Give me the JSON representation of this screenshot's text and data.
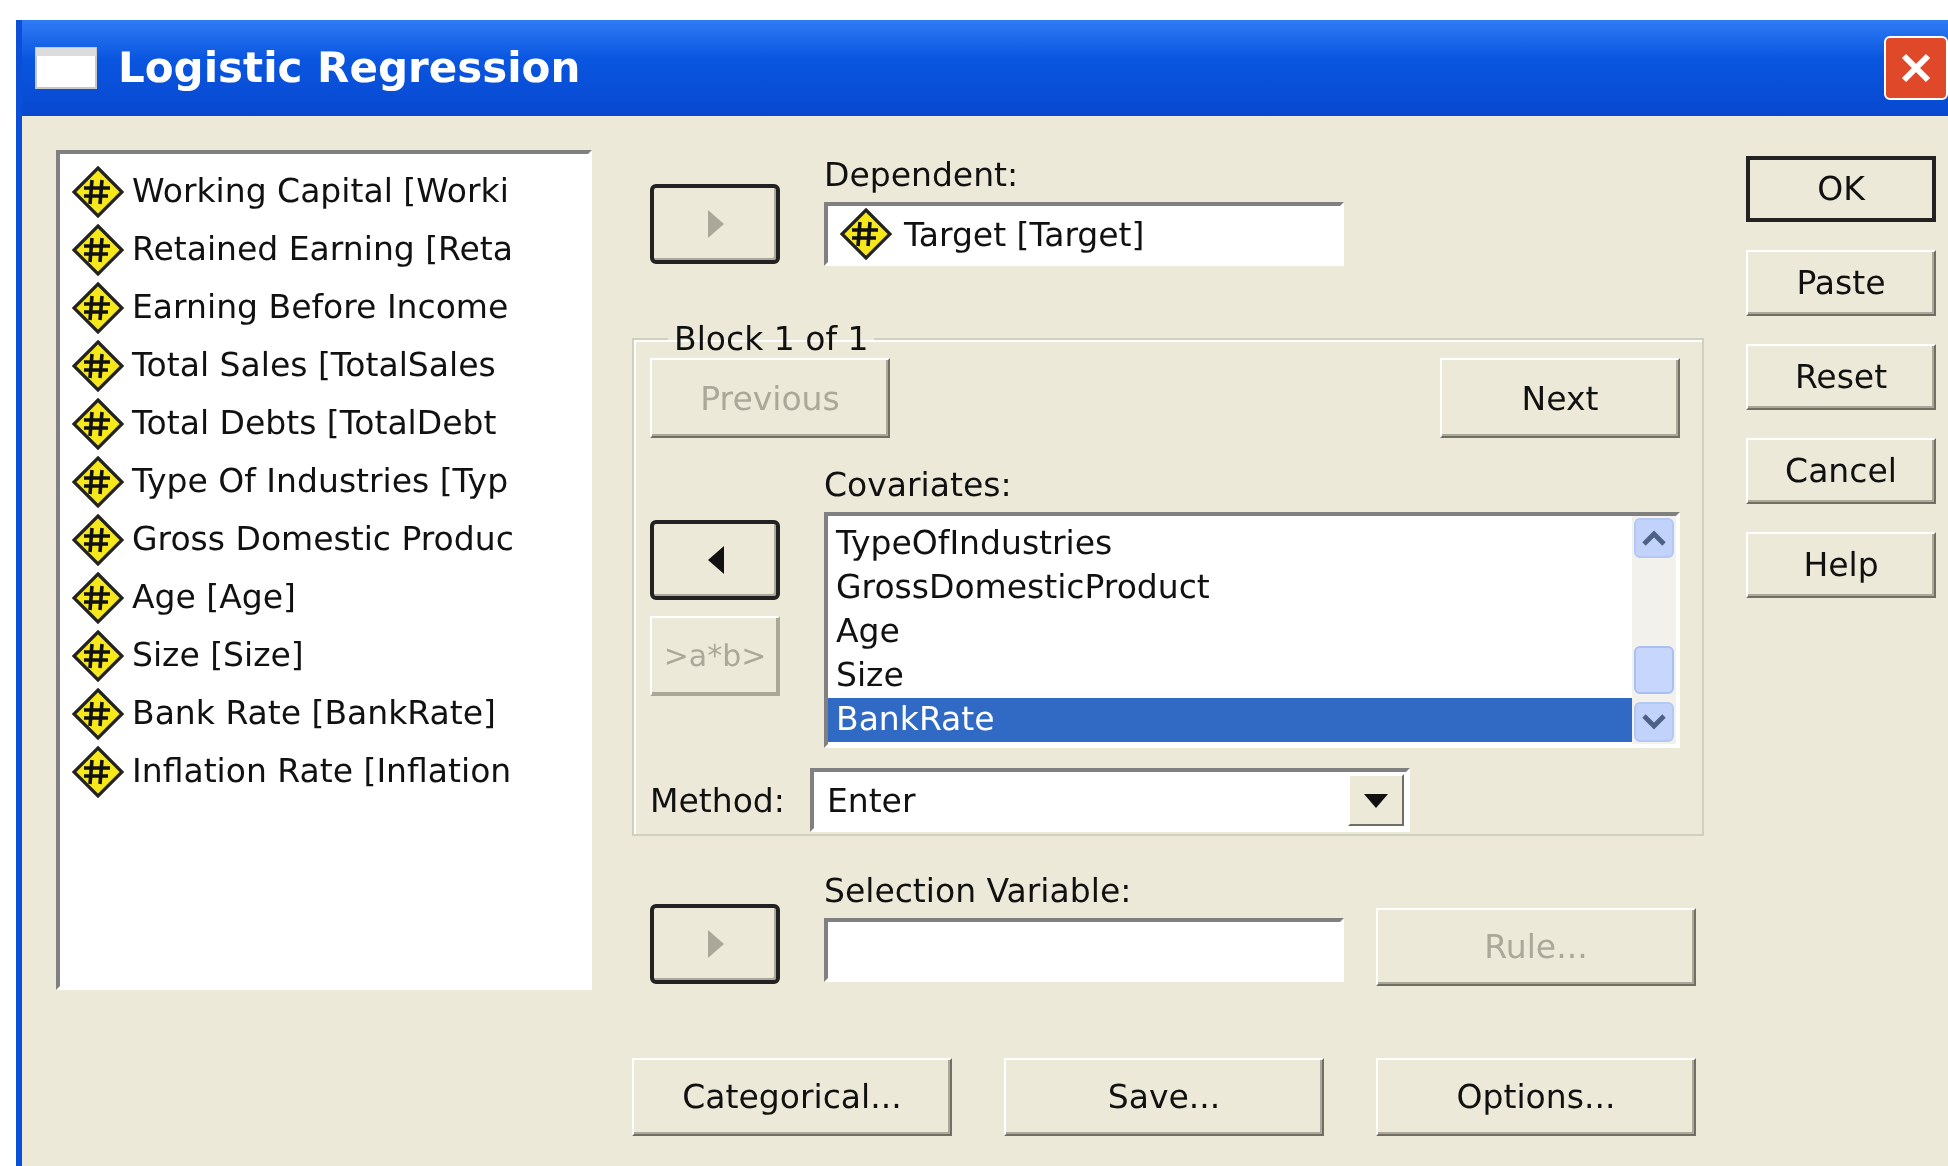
{
  "window": {
    "title": "Logistic Regression"
  },
  "variables": [
    {
      "label": "Working Capital [Worki"
    },
    {
      "label": "Retained Earning [Reta"
    },
    {
      "label": "Earning Before Income"
    },
    {
      "label": "Total Sales [TotalSales"
    },
    {
      "label": "Total Debts [TotalDebt"
    },
    {
      "label": "Type Of Industries [Typ"
    },
    {
      "label": "Gross Domestic Produc"
    },
    {
      "label": "Age [Age]"
    },
    {
      "label": "Size [Size]"
    },
    {
      "label": "Bank Rate [BankRate]"
    },
    {
      "label": "Inflation Rate [Inflation"
    }
  ],
  "dependent": {
    "arrow": {
      "kind": "right",
      "disabled": true
    },
    "label": "Dependent:",
    "value": "Target [Target]"
  },
  "block": {
    "legend": "Block 1 of 1",
    "previous": {
      "label": "Previous",
      "disabled": true
    },
    "next": {
      "label": "Next",
      "disabled": false
    },
    "covariates_label": "Covariates:",
    "arrow": {
      "kind": "left",
      "disabled": false
    },
    "interaction": {
      "label": ">a*b>",
      "disabled": true
    },
    "covariates": [
      {
        "label": "TypeOfIndustries",
        "selected": false
      },
      {
        "label": "GrossDomesticProduct",
        "selected": false
      },
      {
        "label": "Age",
        "selected": false
      },
      {
        "label": "Size",
        "selected": false
      },
      {
        "label": "BankRate",
        "selected": true
      }
    ],
    "method_label": "Method:",
    "method": "Enter"
  },
  "selection": {
    "arrow": {
      "kind": "right",
      "disabled": true
    },
    "label": "Selection Variable:",
    "rule": {
      "label": "Rule...",
      "disabled": true
    }
  },
  "side_buttons": [
    {
      "label": "OK",
      "default": true
    },
    {
      "label": "Paste",
      "default": false
    },
    {
      "label": "Reset",
      "default": false
    },
    {
      "label": "Cancel",
      "default": false
    },
    {
      "label": "Help",
      "default": false
    }
  ],
  "bottom_buttons": [
    {
      "label": "Categorical..."
    },
    {
      "label": "Save..."
    },
    {
      "label": "Options..."
    }
  ]
}
